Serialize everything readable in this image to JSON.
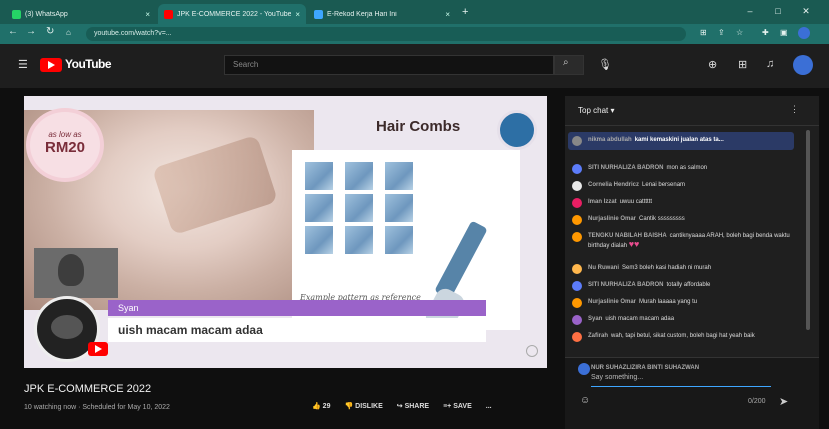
{
  "browser": {
    "tabs": [
      {
        "label": "(3) WhatsApp",
        "active": false,
        "icon": "whatsapp-icon",
        "color": "#25d366"
      },
      {
        "label": "JPK E-COMMERCE 2022 - YouTube",
        "active": true,
        "icon": "youtube-icon",
        "color": "#ff0000"
      },
      {
        "label": "E-Rekod Kerja Hari Ini",
        "active": false,
        "icon": "page-icon",
        "color": "#3ea6ff"
      }
    ],
    "url": "youtube.com/watch?v=...",
    "new_tab": "+"
  },
  "youtube": {
    "logo_text": "YouTube",
    "search_placeholder": "Search"
  },
  "video": {
    "price_prefix": "as low as",
    "price": "RM20",
    "product_title": "Hair Combs",
    "panel_caption": "Example pattern as reference",
    "overlay_name": "Syan",
    "overlay_message": "uish macam macam adaa"
  },
  "meta": {
    "title": "JPK E-COMMERCE 2022",
    "subtitle": "10 watching now · Scheduled for May 10, 2022",
    "likes": "29",
    "dislike": "DISLIKE",
    "share": "SHARE",
    "save": "SAVE",
    "more": "..."
  },
  "chat": {
    "header": "Top chat",
    "pinned": {
      "author": "nikma abdullah",
      "text": "kami kemaskini jualan atas ta..."
    },
    "messages": [
      {
        "author": "SITI NURHALIZA BADRON",
        "text": "mon as salmon",
        "color": "#5c7cfa"
      },
      {
        "author": "Cornelia Hendricz",
        "text": "Lenai bersenam",
        "color": "#e8e8e8"
      },
      {
        "author": "Iman Izzat",
        "text": "uwuu catttttt",
        "color": "#e91e63"
      },
      {
        "author": "Nurjaslinie Omar",
        "text": "Cantik sssssssss",
        "color": "#ff9800"
      },
      {
        "author": "TENGKU NABILAH BAISHA",
        "text": "cantiknyaaaa ARAH, boleh bagi benda waktu birthday dialah",
        "color": "#ff9800"
      },
      {
        "author": "Nu Ruwani",
        "text": "Sem3 boleh kasi hadiah ni murah",
        "color": "#ffb74d"
      },
      {
        "author": "SITI NURHALIZA BADRON",
        "text": "totally affordable",
        "color": "#5c7cfa"
      },
      {
        "author": "Nurjaslinie Omar",
        "text": "Murah laaaaa yang tu",
        "color": "#ff9800"
      },
      {
        "author": "Syan",
        "text": "uish macam macam adaa",
        "color": "#9a63c9"
      },
      {
        "author": "Zafirah",
        "text": "wah, tapi betul, sikat custom, boleh bagi hat yeah baik",
        "color": "#ff7043"
      }
    ],
    "composer_author": "NUR SUHAZLIZIRA BINTI SUHAZWAN",
    "composer_placeholder": "Say something...",
    "counter": "0/200"
  }
}
